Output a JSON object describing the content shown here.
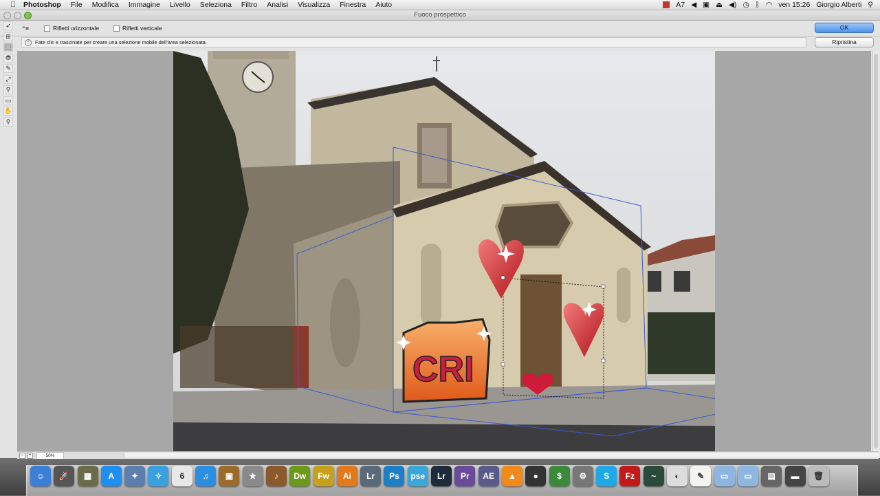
{
  "menubar": {
    "apple": "",
    "app_name": "Photoshop",
    "items": [
      "File",
      "Modifica",
      "Immagine",
      "Livello",
      "Seleziona",
      "Filtro",
      "Analisi",
      "Visualizza",
      "Finestra",
      "Aiuto"
    ],
    "status_items": [
      "7",
      "ven 15:26",
      "Giorgio Alberti"
    ]
  },
  "dialog": {
    "title": "Fuoco prospettico",
    "ok_label": "OK",
    "reset_label": "Ripristina",
    "info_text": "Fate clic e trascinate per creare una selezione mobile dell'area selezionata.",
    "options": {
      "flip_horizontal": "Rifletti orizzontale",
      "flip_vertical": "Rifletti verticale"
    },
    "zoom_level": "50%"
  },
  "tools": [
    {
      "name": "edit-plane-tool-icon",
      "glyph": "➶",
      "selected": false
    },
    {
      "name": "create-plane-tool-icon",
      "glyph": "⊞",
      "selected": false
    },
    {
      "name": "marquee-tool-icon",
      "glyph": "⬚",
      "selected": true
    },
    {
      "name": "stamp-tool-icon",
      "glyph": "⛃",
      "selected": false
    },
    {
      "name": "brush-tool-icon",
      "glyph": "✎",
      "selected": false
    },
    {
      "name": "transform-tool-icon",
      "glyph": "⤢",
      "selected": false
    },
    {
      "name": "eyedropper-tool-icon",
      "glyph": "⚲",
      "selected": false
    },
    {
      "name": "measure-tool-icon",
      "glyph": "▭",
      "selected": false
    },
    {
      "name": "hand-tool-icon",
      "glyph": "✋",
      "selected": false
    },
    {
      "name": "zoom-tool-icon",
      "glyph": "⚲",
      "selected": false
    }
  ],
  "dock": [
    {
      "name": "finder-icon",
      "label": "☺",
      "color": "#3d7fd6"
    },
    {
      "name": "launchpad-icon",
      "label": "🚀",
      "color": "#555"
    },
    {
      "name": "utility-icon",
      "label": "▦",
      "color": "#6b6b4b"
    },
    {
      "name": "app-store-icon",
      "label": "A",
      "color": "#1f8ef1"
    },
    {
      "name": "preview-icon",
      "label": "✦",
      "color": "#5d7fb0"
    },
    {
      "name": "safari-icon",
      "label": "✧",
      "color": "#3aa0e0"
    },
    {
      "name": "calendar-icon",
      "label": "6",
      "color": "#e8e8e8"
    },
    {
      "name": "itunes-icon",
      "label": "♫",
      "color": "#2c8ee0"
    },
    {
      "name": "photos-icon",
      "label": "▣",
      "color": "#9b6b2b"
    },
    {
      "name": "imovie-icon",
      "label": "★",
      "color": "#8a8a8a"
    },
    {
      "name": "garageband-icon",
      "label": "♪",
      "color": "#8a5a2a"
    },
    {
      "name": "dreamweaver-icon",
      "label": "Dw",
      "color": "#6b9a1a"
    },
    {
      "name": "fireworks-icon",
      "label": "Fw",
      "color": "#c7a01a"
    },
    {
      "name": "illustrator-icon",
      "label": "Ai",
      "color": "#e07a1a"
    },
    {
      "name": "lightroom-icon",
      "label": "Lr",
      "color": "#5a6a7a"
    },
    {
      "name": "photoshop-icon",
      "label": "Ps",
      "color": "#1d7fc6"
    },
    {
      "name": "photoshop-elements-icon",
      "label": "pse",
      "color": "#3aa7d8"
    },
    {
      "name": "lightroom-classic-icon",
      "label": "Lr",
      "color": "#1e2b3a"
    },
    {
      "name": "premiere-icon",
      "label": "Pr",
      "color": "#6a4a9a"
    },
    {
      "name": "after-effects-icon",
      "label": "AE",
      "color": "#5a5a8a"
    },
    {
      "name": "vlc-icon",
      "label": "▲",
      "color": "#f08a1a"
    },
    {
      "name": "dvd-player-icon",
      "label": "●",
      "color": "#333"
    },
    {
      "name": "money-icon",
      "label": "$",
      "color": "#3a8a3a"
    },
    {
      "name": "system-preferences-icon",
      "label": "⚙",
      "color": "#777"
    },
    {
      "name": "skype-icon",
      "label": "S",
      "color": "#1ea8e8"
    },
    {
      "name": "filezilla-icon",
      "label": "Fz",
      "color": "#c21a1a"
    },
    {
      "name": "activity-monitor-icon",
      "label": "~",
      "color": "#2a4a3a"
    },
    {
      "name": "disk-utility-icon",
      "label": "◐",
      "color": "#ddd"
    },
    {
      "name": "textedit-icon",
      "label": "✎",
      "color": "#f5f5f0"
    },
    {
      "name": "folder-icon",
      "label": "▭",
      "color": "#8fb6e0"
    },
    {
      "name": "documents-folder-icon",
      "label": "▭",
      "color": "#8fb6e0"
    },
    {
      "name": "downloads-stack-icon",
      "label": "▤",
      "color": "#666"
    },
    {
      "name": "display-icon",
      "label": "▬",
      "color": "#444"
    },
    {
      "name": "trash-icon",
      "label": "🗑",
      "color": "#bbb"
    }
  ]
}
